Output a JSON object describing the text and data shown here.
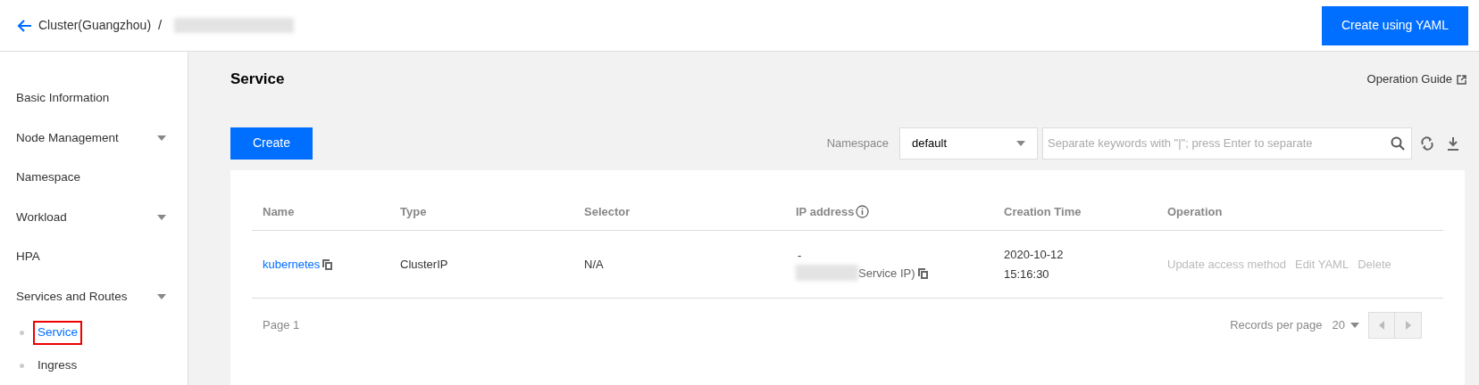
{
  "header": {
    "breadcrumb": "Cluster(Guangzhou)",
    "separator": "/",
    "action": "Create using YAML"
  },
  "sidebar": {
    "items": [
      {
        "label": "Basic Information",
        "expandable": false,
        "selected": false
      },
      {
        "label": "Node Management",
        "expandable": true,
        "selected": false
      },
      {
        "label": "Namespace",
        "expandable": false,
        "selected": false
      },
      {
        "label": "Workload",
        "expandable": true,
        "selected": false
      },
      {
        "label": "HPA",
        "expandable": false,
        "selected": false
      },
      {
        "label": "Services and Routes",
        "expandable": true,
        "selected": false,
        "children": [
          {
            "label": "Service",
            "selected": true
          },
          {
            "label": "Ingress",
            "selected": false
          }
        ]
      }
    ]
  },
  "page": {
    "title": "Service",
    "guide_link": "Operation Guide"
  },
  "toolbar": {
    "create": "Create",
    "namespace_label": "Namespace",
    "namespace_value": "default",
    "search": {
      "placeholder": "Separate keywords with \"|\"; press Enter to separate"
    }
  },
  "table": {
    "columns": [
      "Name",
      "Type",
      "Selector",
      "IP address",
      "Creation Time",
      "Operation"
    ],
    "rows": [
      {
        "name": "kubernetes",
        "type": "ClusterIP",
        "selector": "N/A",
        "ip_line_1": "-",
        "ip_line_2": "Service IP)",
        "creation_date": "2020-10-12",
        "creation_time": "15:16:30",
        "operations": [
          "Update access method",
          "Edit YAML",
          "Delete"
        ]
      }
    ]
  },
  "footer": {
    "page": "Page 1",
    "records_label": "Records per page",
    "records_value": "20"
  }
}
